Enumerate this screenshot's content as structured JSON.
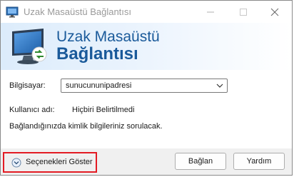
{
  "window": {
    "title": "Uzak Masaüstü Bağlantısı",
    "controls": [
      "minimize-icon",
      "maximize-icon",
      "close-icon"
    ]
  },
  "banner": {
    "line1": "Uzak Masaüstü",
    "line2": "Bağlantısı",
    "icon": "remote-desktop-icon"
  },
  "form": {
    "computer_label": "Bilgisayar:",
    "computer_value": "sunucununipadresi",
    "user_label": "Kullanıcı adı:",
    "user_value": "Hiçbiri Belirtilmedi",
    "info_text": "Bağlandığınızda kimlik bilgileriniz sorulacak."
  },
  "footer": {
    "options_label": "Seçenekleri Göster",
    "connect_label": "Bağlan",
    "help_label": "Yardım"
  },
  "colors": {
    "accent": "#1a5a9a",
    "highlight_border": "#e31b23"
  }
}
